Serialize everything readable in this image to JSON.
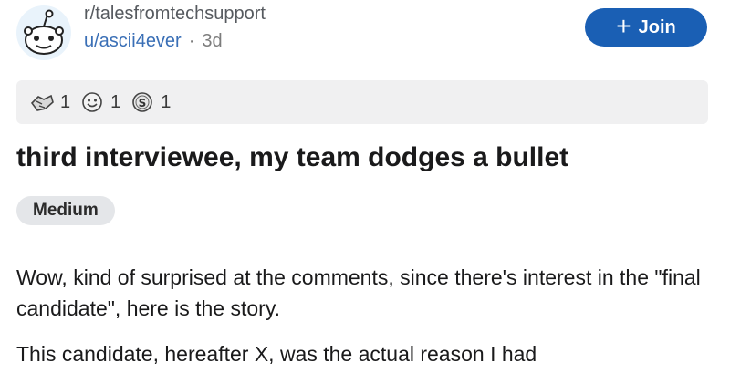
{
  "post": {
    "subreddit": "r/talesfromtechsupport",
    "author": "u/ascii4ever",
    "separator": "·",
    "age": "3d",
    "join_label": "Join",
    "awards": [
      {
        "icon": "helpful-award-icon",
        "count": "1"
      },
      {
        "icon": "wholesome-award-icon",
        "count": "1"
      },
      {
        "icon": "silver-award-icon",
        "count": "1"
      }
    ],
    "title": "third interviewee, my team dodges a bullet",
    "flair": "Medium",
    "paragraphs": [
      "Wow, kind of surprised at the comments, since there's interest in the \"final candidate\", here is the story.",
      "This candidate, hereafter X, was the actual reason I had"
    ]
  },
  "colors": {
    "join_button": "#1a5fb4",
    "username": "#3a6fb6",
    "flair_bg": "#e4e6e9",
    "award_bar_bg": "#f0f0f1"
  }
}
